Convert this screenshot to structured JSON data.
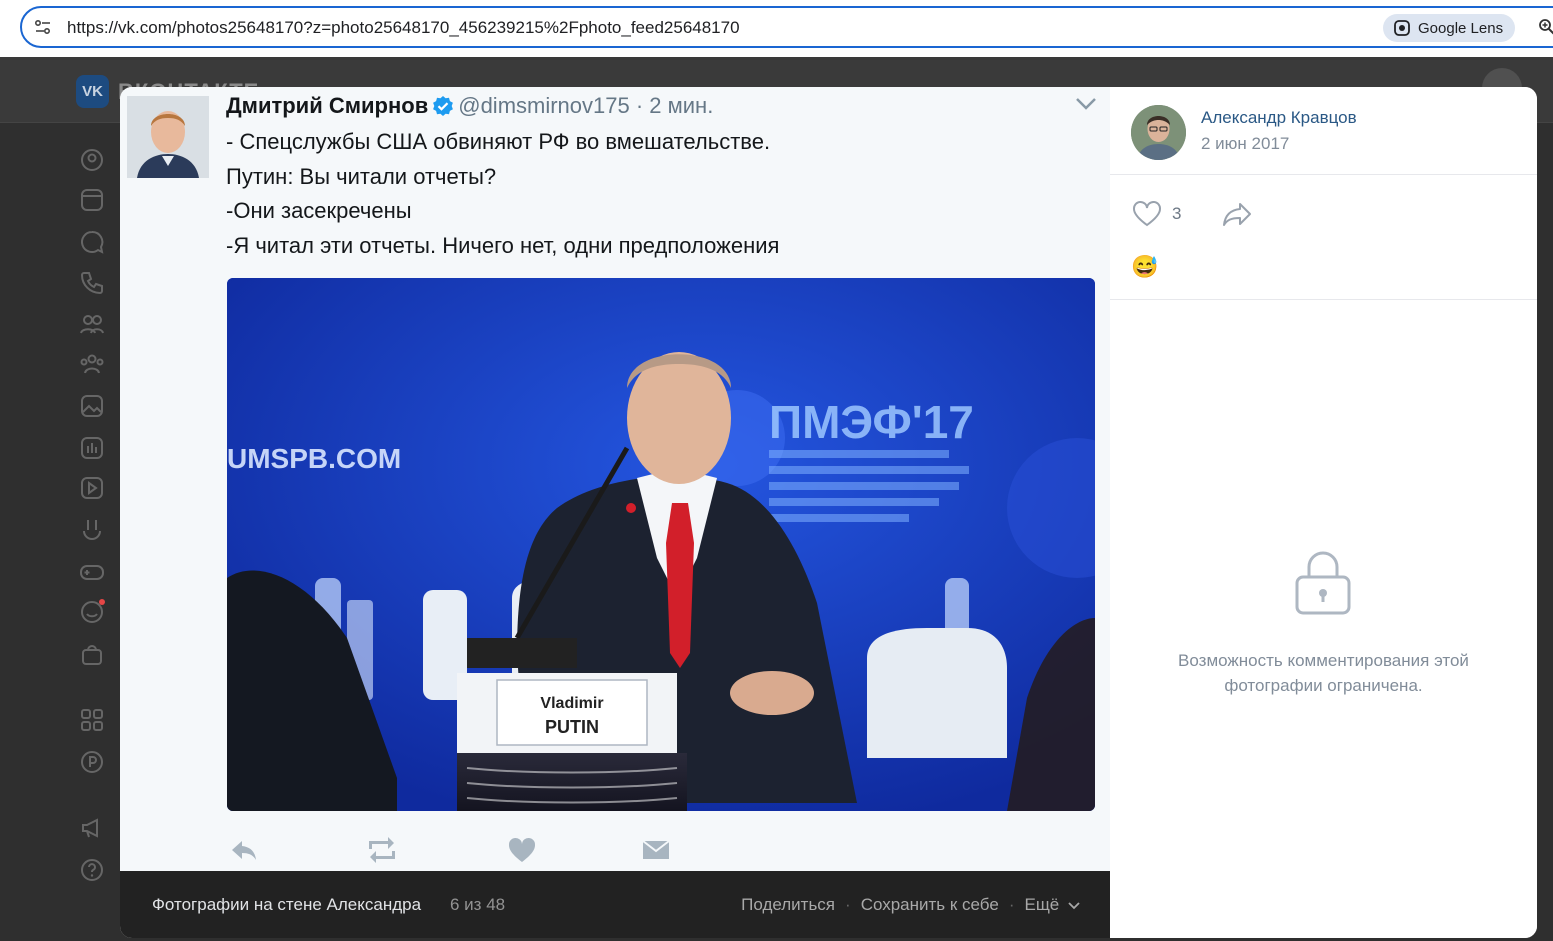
{
  "browser": {
    "url": "https://vk.com/photos25648170?z=photo25648170_456239215%2Fphoto_feed25648170",
    "lens_label": "Google Lens"
  },
  "vk": {
    "brand": "ВКОНТАКТЕ",
    "nav_icons": [
      "profile-icon",
      "news-icon",
      "messenger-icon",
      "calls-icon",
      "friends-icon",
      "communities-icon",
      "photos-icon",
      "music-icon",
      "video-icon",
      "clips-icon",
      "games-icon",
      "stickers-icon",
      "market-icon",
      "services-icon",
      "vkpay-icon",
      "ads-icon",
      "help-icon"
    ]
  },
  "tweet": {
    "name": "Дмитрий Смирнов",
    "handle": "@dimsmirnov175 · 2 мин.",
    "lines": [
      "- Спецслужбы США обвиняют РФ во вмешательстве.",
      "Путин: Вы читали отчеты?",
      "-Они засекречены",
      "-Я читал эти отчеты. Ничего нет, одни предположения"
    ],
    "image_texts": {
      "left_sign": "UMSPB.COM",
      "forum_logo": "ПМЭФ'17",
      "nameplate_first": "Vladimir",
      "nameplate_last": "PUTIN"
    }
  },
  "viewer_bar": {
    "title": "Фотографии на стене Александра",
    "count": "6 из 48",
    "share": "Поделиться",
    "save": "Сохранить к себе",
    "more": "Ещё"
  },
  "sidebar": {
    "author_name": "Александр Кравцов",
    "date": "2 июн 2017",
    "likes": "3",
    "reaction_emoji": "😅",
    "comments_locked_text": "Возможность комментирования этой фотографии ограничена."
  },
  "colors": {
    "url_border": "#1a66d2",
    "vk_link": "#2a5885",
    "tweet_blue": "#1d9bf0",
    "photo_bg": "#1637b8"
  }
}
